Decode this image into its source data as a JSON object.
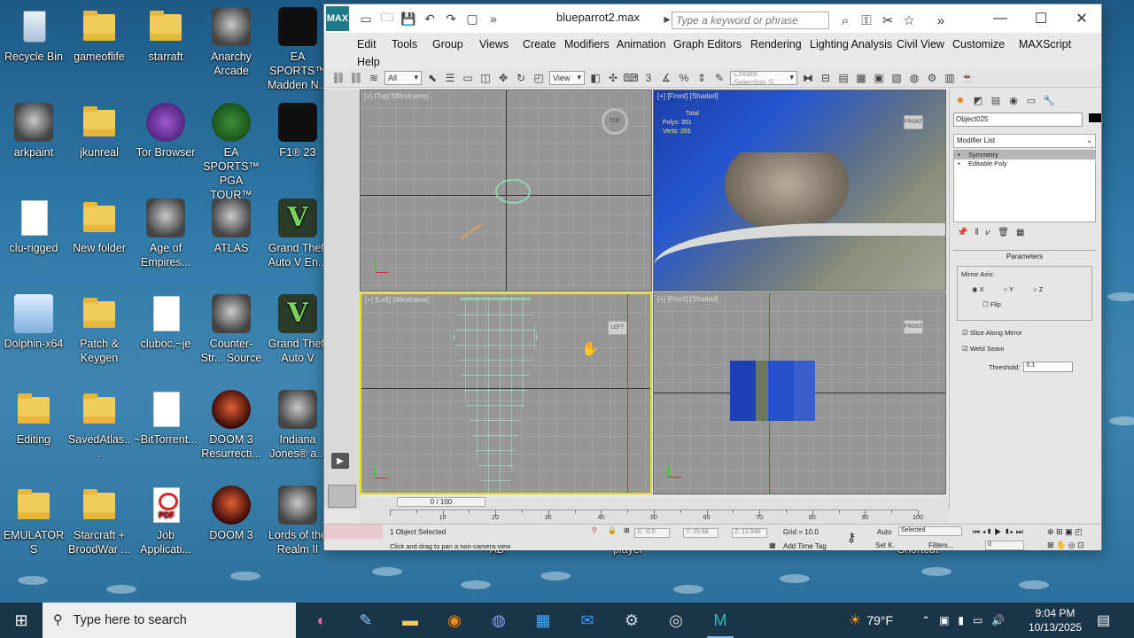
{
  "desktop": {
    "icons": [
      {
        "label": "Recycle Bin"
      },
      {
        "label": "gameoflife"
      },
      {
        "label": "starraft"
      },
      {
        "label": "Anarchy Arcade"
      },
      {
        "label": "EA SPORTS™ Madden N..."
      },
      {
        "label": "arkpaint"
      },
      {
        "label": "jkunreal"
      },
      {
        "label": "Tor Browser"
      },
      {
        "label": "EA SPORTS™ PGA TOUR™"
      },
      {
        "label": "F1® 23"
      },
      {
        "label": "clu-rigged"
      },
      {
        "label": "New folder"
      },
      {
        "label": "Age of Empires..."
      },
      {
        "label": "ATLAS"
      },
      {
        "label": "Grand Theft Auto V En..."
      },
      {
        "label": "Dolphin-x64"
      },
      {
        "label": "Patch & Keygen"
      },
      {
        "label": "cluboc.~je"
      },
      {
        "label": "Counter-Str... Source"
      },
      {
        "label": "Grand Theft Auto V"
      },
      {
        "label": "Editing"
      },
      {
        "label": "SavedAtlas..."
      },
      {
        "label": "~BitTorrent..."
      },
      {
        "label": "DOOM 3 Resurrecti..."
      },
      {
        "label": "Indiana Jones® a..."
      },
      {
        "label": "EMULATORS"
      },
      {
        "label": "Starcraft + BroodWar ..."
      },
      {
        "label": "Job Applicati..."
      },
      {
        "label": "DOOM 3"
      },
      {
        "label": "Lords of the Realm II"
      }
    ],
    "behind_labels": {
      "a": "AD",
      "b": "player",
      "c": "Shortcut"
    }
  },
  "max": {
    "logo": "MAX",
    "title": "blueparrot2.max",
    "search_placeholder": "Type a keyword or phrase",
    "menus": [
      "Edit",
      "Tools",
      "Group",
      "Views",
      "Create",
      "Modifiers",
      "Animation",
      "Graph Editors",
      "Rendering",
      "Lighting Analysis",
      "Civil View",
      "Customize",
      "MAXScript",
      "Help"
    ],
    "toolbar": {
      "filter": "All",
      "refcoord": "View",
      "selset": "Create Selection S"
    },
    "viewports": {
      "top": "[+] [Top] [Wireframe]",
      "front1": "[+] [Front] [Shaded]",
      "left": "[+] [Left] [Wireframe]",
      "front2": "[+] [Front] [Shaded]",
      "stats_total": "Total",
      "stats_polys": "Polys:  351",
      "stats_verts": "Verts:  355",
      "cube_top": "TOP",
      "cube_front": "FRONT",
      "cube_left": "LEFT"
    },
    "cmdpanel": {
      "object_name": "Object025",
      "modifier_list": "Modifier List",
      "stack": [
        "Symmetry",
        "Editable Poly"
      ],
      "params_title": "Parameters",
      "mirror_axis": "Mirror Axis:",
      "axis_x": "X",
      "axis_y": "Y",
      "axis_z": "Z",
      "flip": "Flip",
      "slice": "Slice Along Mirror",
      "weld": "Weld Seam",
      "threshold_label": "Threshold:",
      "threshold_value": "0.1"
    },
    "timeline": {
      "frame": "0 / 100",
      "ticks": [
        "10",
        "20",
        "30",
        "40",
        "50",
        "60",
        "70",
        "80",
        "90",
        "100"
      ]
    },
    "status": {
      "selected": "1 Object Selected",
      "hint": "Click and drag to pan a non-camera view",
      "x": "X: -0.0",
      "y": "Y: 29.68",
      "z": "Z: 13.949",
      "grid": "Grid = 10.0",
      "add_time_tag": "Add Time Tag",
      "auto": "Auto",
      "setk": "Set K.",
      "sel_dd": "Selected",
      "filters": "Filters...",
      "frame_field": "0"
    }
  },
  "taskbar": {
    "search_placeholder": "Type here to search",
    "weather": "79°F",
    "time": "9:04 PM",
    "date": "10/13/2025"
  }
}
